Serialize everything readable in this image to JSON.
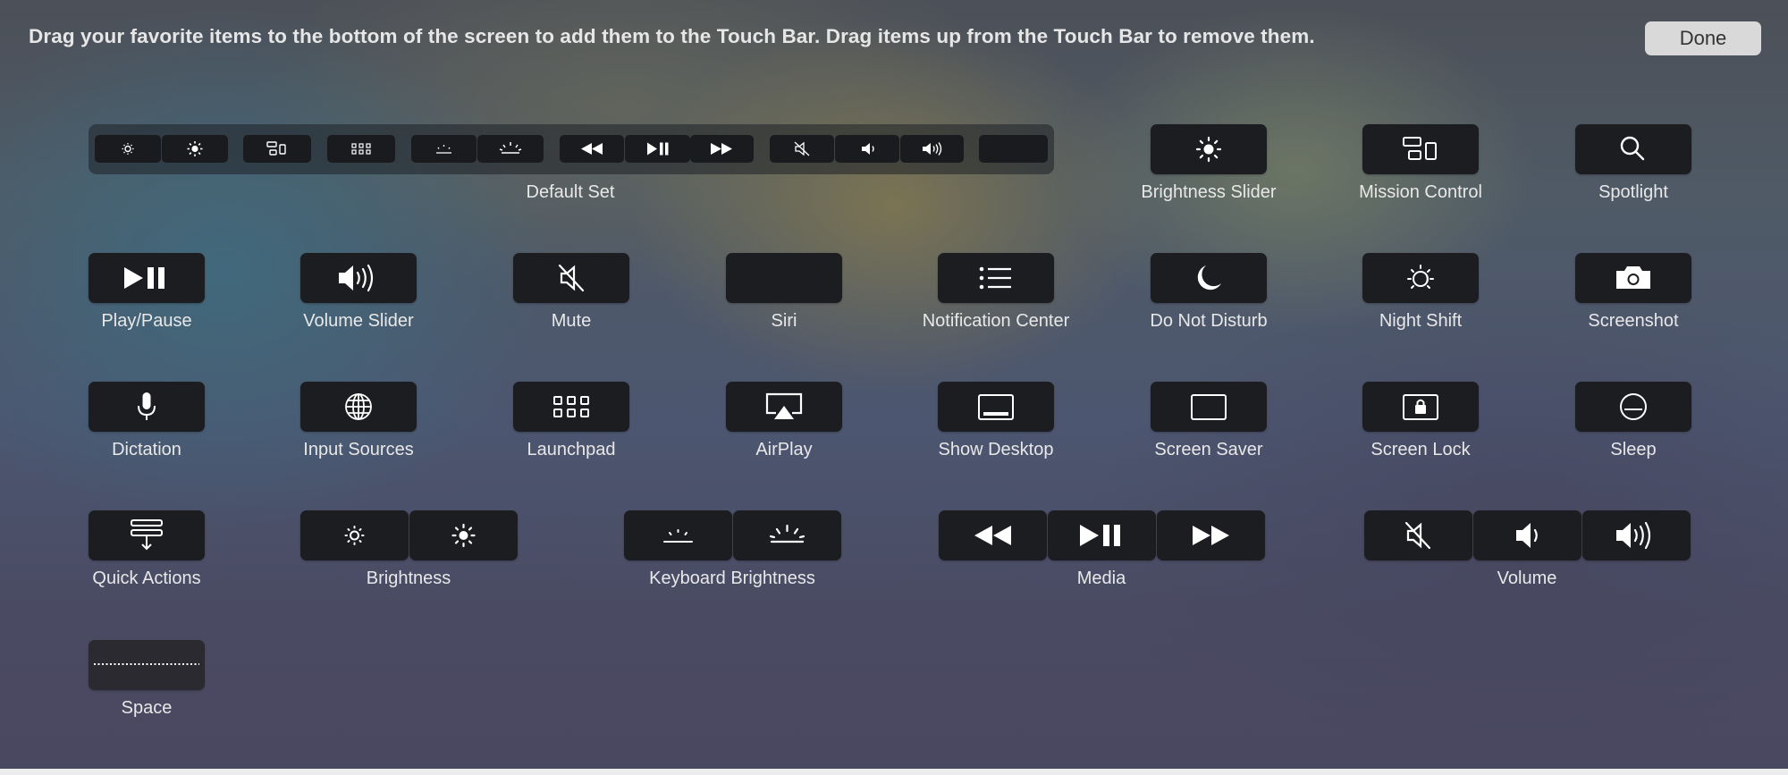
{
  "instruction": "Drag your favorite items to the bottom of the screen to add them to the Touch Bar. Drag items up from the Touch Bar to remove them.",
  "done_label": "Done",
  "default_set_label": "Default Set",
  "items": {
    "brightness_slider": "Brightness Slider",
    "mission_control": "Mission Control",
    "spotlight": "Spotlight",
    "play_pause": "Play/Pause",
    "volume_slider": "Volume Slider",
    "mute": "Mute",
    "siri": "Siri",
    "notification_center": "Notification Center",
    "do_not_disturb": "Do Not Disturb",
    "night_shift": "Night Shift",
    "screenshot": "Screenshot",
    "dictation": "Dictation",
    "input_sources": "Input Sources",
    "launchpad": "Launchpad",
    "airplay": "AirPlay",
    "show_desktop": "Show Desktop",
    "screen_saver": "Screen Saver",
    "screen_lock": "Screen Lock",
    "sleep": "Sleep",
    "quick_actions": "Quick Actions",
    "brightness": "Brightness",
    "keyboard_brightness": "Keyboard Brightness",
    "media": "Media",
    "volume": "Volume",
    "space": "Space"
  },
  "icons": {
    "brightness_slider": "sun-icon",
    "mission_control": "mission-control-icon",
    "spotlight": "magnifier-icon",
    "play_pause": "play-pause-icon",
    "volume_slider": "speaker-loud-icon",
    "mute": "speaker-muted-icon",
    "notification_center": "list-icon",
    "do_not_disturb": "moon-icon",
    "night_shift": "night-shift-icon",
    "screenshot": "camera-icon",
    "dictation": "microphone-icon",
    "input_sources": "globe-icon",
    "launchpad": "grid-icon",
    "airplay": "airplay-icon",
    "show_desktop": "desktop-icon",
    "screen_saver": "screen-saver-icon",
    "screen_lock": "lock-icon",
    "sleep": "sleep-icon",
    "quick_actions": "quick-actions-icon"
  },
  "colors": {
    "button_bg": "#1c1d20",
    "label": "#e8e8e8",
    "done_bg": "#d9d9d9"
  }
}
